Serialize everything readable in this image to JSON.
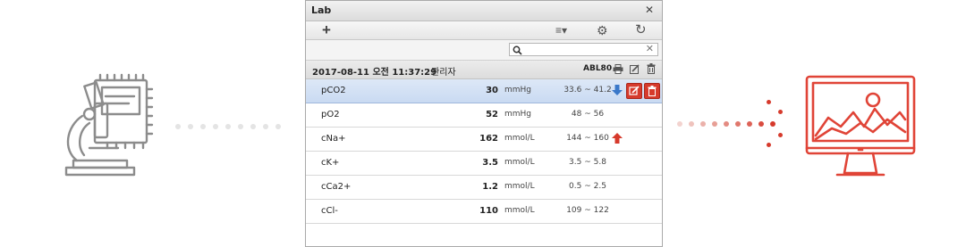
{
  "window": {
    "title": "Lab",
    "close_glyph": "✕"
  },
  "toolbar": {
    "add_glyph": "+",
    "menu_glyph": "≡▾",
    "settings_glyph": "⚙",
    "refresh_glyph": "↻"
  },
  "search": {
    "value": "",
    "placeholder": "",
    "clear_glyph": "✕"
  },
  "record": {
    "datetime": "2017-08-11 오전 11:37:29",
    "user": "관리자",
    "device": "ABL80"
  },
  "rows": [
    {
      "name": "pCO2",
      "value": "30",
      "unit": "mmHg",
      "range": "33.6 ~ 41.2",
      "flag": "low"
    },
    {
      "name": "pO2",
      "value": "52",
      "unit": "mmHg",
      "range": "48 ~ 56",
      "flag": ""
    },
    {
      "name": "cNa+",
      "value": "162",
      "unit": "mmol/L",
      "range": "144 ~ 160",
      "flag": "high"
    },
    {
      "name": "cK+",
      "value": "3.5",
      "unit": "mmol/L",
      "range": "3.5 ~ 5.8",
      "flag": ""
    },
    {
      "name": "cCa2+",
      "value": "1.2",
      "unit": "mmol/L",
      "range": "0.5 ~ 2.5",
      "flag": ""
    },
    {
      "name": "cCl-",
      "value": "110",
      "unit": "mmol/L",
      "range": "109 ~ 122",
      "flag": ""
    }
  ],
  "colors": {
    "accent_red": "#d63a2c",
    "flag_low": "#3a78c9",
    "flag_high": "#d63a2c",
    "icon_gray": "#8c8c8c"
  },
  "icons": {
    "left": "microscope-icon",
    "right": "monitor-chart-icon"
  }
}
